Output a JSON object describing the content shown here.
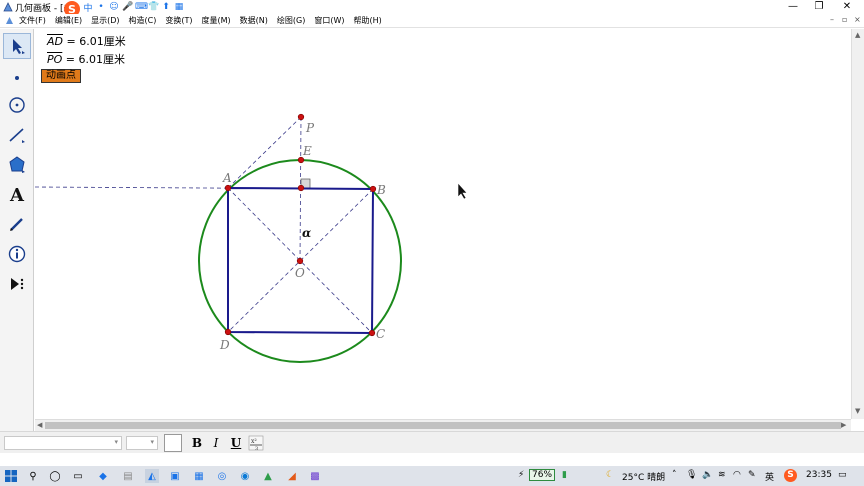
{
  "window": {
    "title": "几何画板 - [未"
  },
  "ime": {
    "logo": "S",
    "items": [
      "中",
      "•",
      "☺",
      "🎤",
      "⌨",
      "👕",
      "⬆",
      "▦"
    ]
  },
  "window_controls": {
    "minimize": "—",
    "restore": "❐",
    "close": "✕"
  },
  "menu": {
    "items": [
      "文件(F)",
      "编辑(E)",
      "显示(D)",
      "构造(C)",
      "变换(T)",
      "度量(M)",
      "数据(N)",
      "绘图(G)",
      "窗口(W)",
      "帮助(H)"
    ],
    "doc_controls": [
      "–",
      "▫",
      "×"
    ]
  },
  "measurements": [
    {
      "segment": "AD",
      "rest": " = 6.01厘米"
    },
    {
      "segment": "PO",
      "rest": " = 6.01厘米"
    }
  ],
  "animate_button": "动画点",
  "figure": {
    "labels": {
      "A": "A",
      "B": "B",
      "C": "C",
      "D": "D",
      "E": "E",
      "O": "O",
      "P": "P",
      "alpha": "α"
    },
    "colors": {
      "circle": "#1c8a1c",
      "square": "#1a1a8c",
      "dashed": "#3a3a8a",
      "point": "#cc1111"
    }
  },
  "toolbox": {
    "tools": [
      "arrow-select",
      "point",
      "compass",
      "straightedge",
      "polygon",
      "text",
      "marker",
      "information",
      "custom-tools"
    ],
    "text_glyph": "A"
  },
  "format_bar": {
    "bold": "B",
    "italic": "I",
    "underline": "U"
  },
  "taskbar": {
    "battery": "76%",
    "weather": "25°C 晴朗",
    "time": "23:35",
    "ime_lang": "英",
    "tray_s": "S"
  }
}
